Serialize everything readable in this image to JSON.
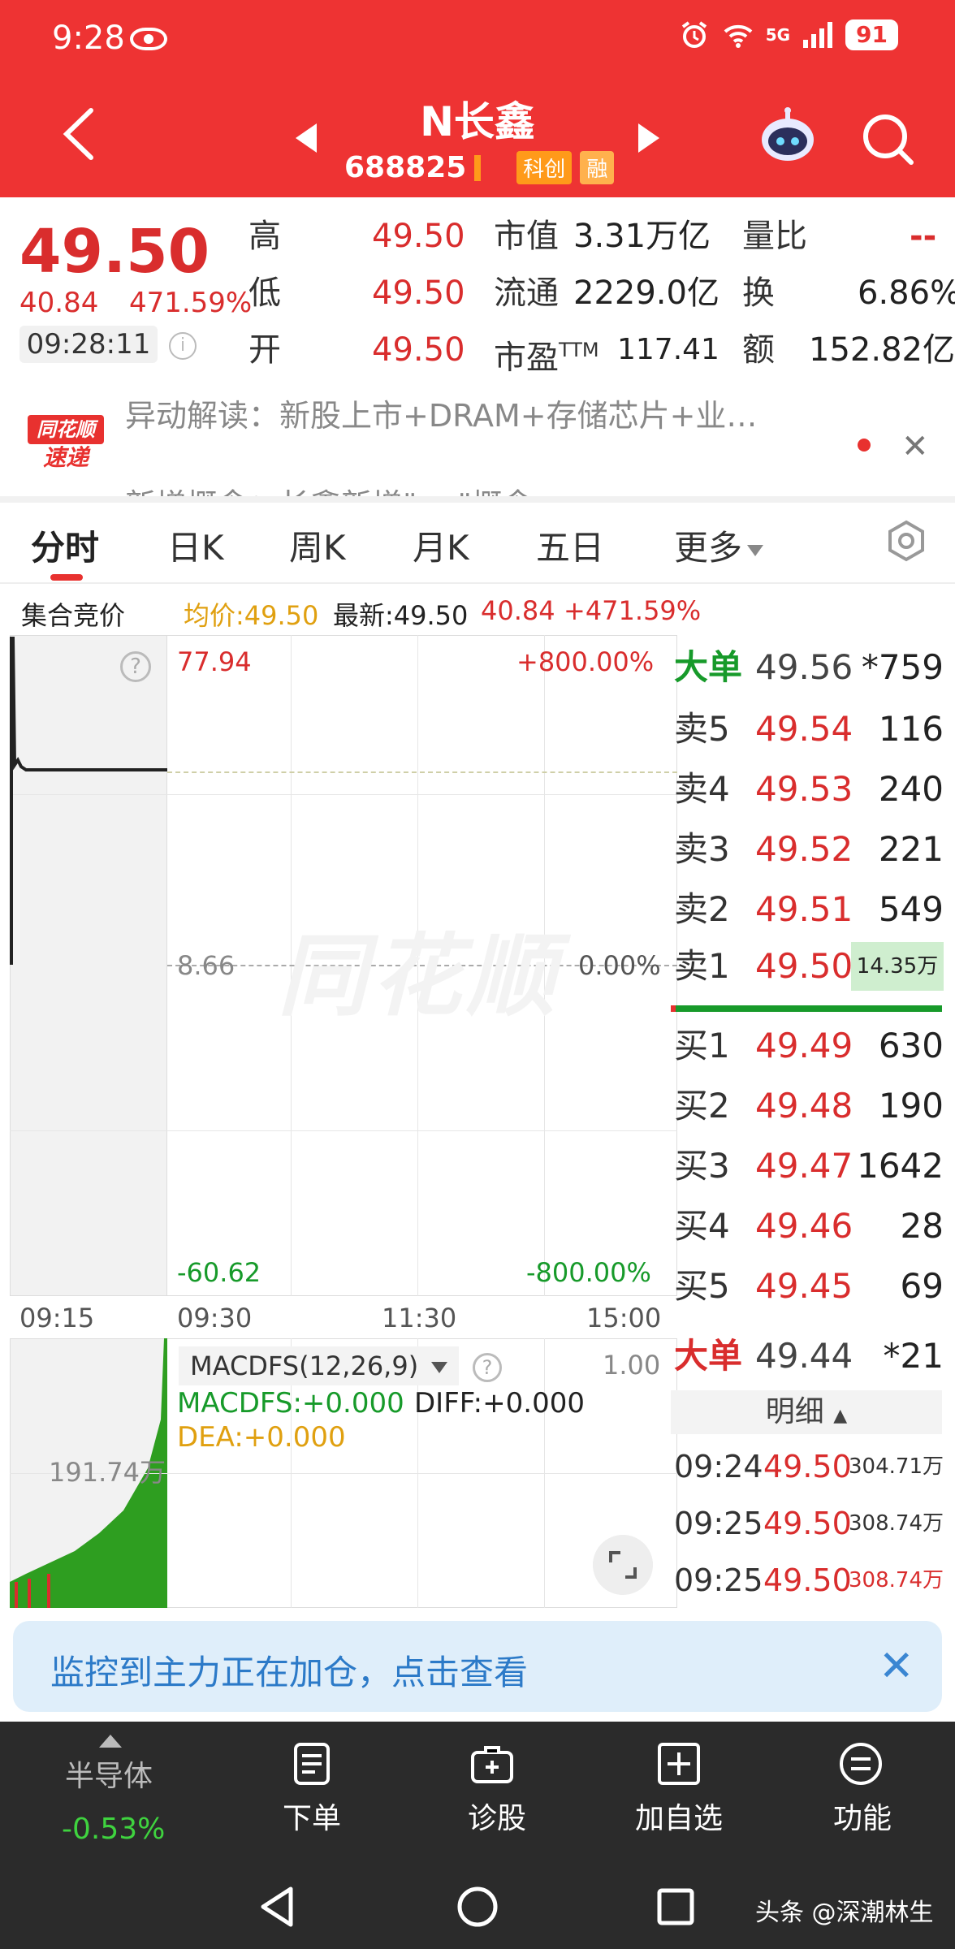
{
  "status_bar": {
    "time": "9:28",
    "network": "5G",
    "battery": "91"
  },
  "header": {
    "name": "N长鑫",
    "code": "688825",
    "tags": [
      "科创",
      "融"
    ]
  },
  "quote": {
    "price": "49.50",
    "change": "40.84",
    "change_pct": "471.59%",
    "time": "09:28:11",
    "fields": [
      {
        "label": "高",
        "value": "49.50"
      },
      {
        "label": "低",
        "value": "49.50"
      },
      {
        "label": "开",
        "value": "49.50"
      }
    ],
    "market_cap": {
      "label": "市值",
      "value": "3.31万亿"
    },
    "float_cap": {
      "label": "流通",
      "value": "2229.0亿"
    },
    "pe": {
      "label": "市盈",
      "suffix": "TTM",
      "value": "117.41"
    },
    "vol_ratio": {
      "label": "量比",
      "value": "--"
    },
    "turnover": {
      "label": "换",
      "value": "6.86%"
    },
    "amount": {
      "label": "额",
      "value": "152.82亿"
    }
  },
  "news": {
    "logo_top": "同花顺",
    "logo_bottom": "速递",
    "line1": "异动解读：新股上市+DRAM+存储芯片+业…",
    "line2": "新增概念：长鑫新增\"… \"概念"
  },
  "tabs": [
    "分时",
    "日K",
    "周K",
    "月K",
    "五日",
    "更多"
  ],
  "chart_header": {
    "label": "集合竞价",
    "avg": "均价:49.50",
    "latest": "最新:49.50",
    "change": "40.84",
    "change_pct": "+471.59%"
  },
  "price_chart": {
    "top_price": "77.94",
    "top_pct": "+800.00%",
    "mid_price": "8.66",
    "mid_pct": "0.00%",
    "bottom_price": "-60.62",
    "bottom_pct": "-800.00%",
    "watermark": "同花顺",
    "times": [
      "09:15",
      "09:30",
      "11:30",
      "15:00"
    ]
  },
  "macd": {
    "selector": "MACDFS(12,26,9)",
    "scale": "1.00",
    "macdfs": "MACDFS:+0.000",
    "diff": "DIFF:+0.000",
    "dea": "DEA:+0.000",
    "volume_label": "191.74万"
  },
  "order_book": {
    "big_sell": {
      "label": "大单",
      "price": "49.56",
      "vol": "*759"
    },
    "asks": [
      {
        "label": "卖5",
        "price": "49.54",
        "vol": "116"
      },
      {
        "label": "卖4",
        "price": "49.53",
        "vol": "240"
      },
      {
        "label": "卖3",
        "price": "49.52",
        "vol": "221"
      },
      {
        "label": "卖2",
        "price": "49.51",
        "vol": "549"
      },
      {
        "label": "卖1",
        "price": "49.50",
        "vol": "14.35万"
      }
    ],
    "bids": [
      {
        "label": "买1",
        "price": "49.49",
        "vol": "630"
      },
      {
        "label": "买2",
        "price": "49.48",
        "vol": "190"
      },
      {
        "label": "买3",
        "price": "49.47",
        "vol": "1642"
      },
      {
        "label": "买4",
        "price": "49.46",
        "vol": "28"
      },
      {
        "label": "买5",
        "price": "49.45",
        "vol": "69"
      }
    ],
    "big_buy": {
      "label": "大单",
      "price": "49.44",
      "vol": "*21"
    },
    "detail_label": "明细",
    "ticks": [
      {
        "time": "09:24",
        "price": "49.50",
        "vol": "304.71万"
      },
      {
        "time": "09:25",
        "price": "49.50",
        "vol": "308.74万"
      },
      {
        "time": "09:25",
        "price": "49.50",
        "vol": "308.74万"
      }
    ]
  },
  "alert": {
    "text": "监控到主力正在加仓，点击查看"
  },
  "toolbar": {
    "sector_name": "半导体",
    "sector_change": "-0.53%",
    "items": [
      "下单",
      "诊股",
      "加自选",
      "功能"
    ]
  },
  "credit": "头条 @深潮林生",
  "colors": {
    "red": "#ee3333",
    "up": "#d92d2d",
    "down": "#179a2a",
    "accent_blue": "#2c7ac8"
  }
}
